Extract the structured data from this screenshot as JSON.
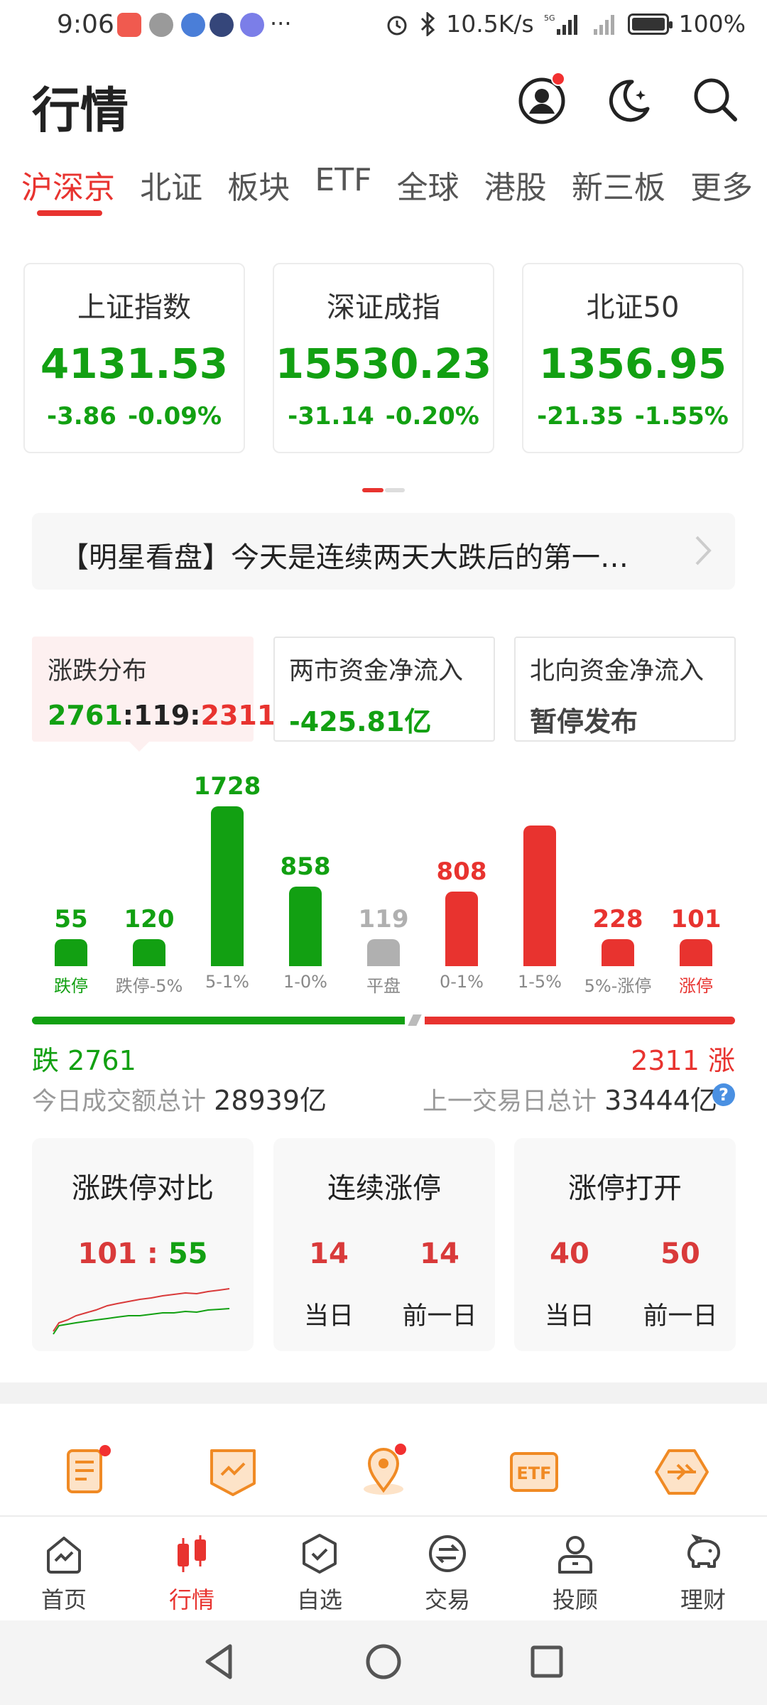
{
  "status_bar": {
    "time": "9:06",
    "more": "···",
    "net_speed": "10.5K/s",
    "network": "5G",
    "battery": "100%"
  },
  "header": {
    "title": "行情",
    "icons": [
      "profile-icon",
      "night-mode-icon",
      "search-icon"
    ]
  },
  "tabs": [
    "沪深京",
    "北证",
    "板块",
    "ETF",
    "全球",
    "港股",
    "新三板",
    "更多"
  ],
  "indices": [
    {
      "name": "上证指数",
      "value": "4131.53",
      "change": "-3.86",
      "pct": "-0.09%"
    },
    {
      "name": "深证成指",
      "value": "15530.23",
      "change": "-31.14",
      "pct": "-0.20%"
    },
    {
      "name": "北证50",
      "value": "1356.95",
      "change": "-21.35",
      "pct": "-1.55%"
    }
  ],
  "news": {
    "text": "【明星看盘】今天是连续两天大跌后的第一…"
  },
  "stats": {
    "distribution": {
      "label": "涨跌分布",
      "fall": "2761",
      "sep1": ":",
      "flat": "119",
      "sep2": ":",
      "rise": "2311"
    },
    "net_flow": {
      "label": "两市资金净流入",
      "value": "-425.81亿"
    },
    "north_flow": {
      "label": "北向资金净流入",
      "value": "暂停发布"
    }
  },
  "chart_data": {
    "type": "bar",
    "categories": [
      "跌停",
      "跌停-5%",
      "5-1%",
      "1-0%",
      "平盘",
      "0-1%",
      "1-5%",
      "5%-涨停",
      "涨停"
    ],
    "values": [
      55,
      120,
      1728,
      858,
      119,
      808,
      null,
      228,
      101
    ],
    "value_labels": [
      "55",
      "120",
      "1728",
      "858",
      "119",
      "808",
      "",
      "228",
      "101"
    ],
    "colors": [
      "#12a012",
      "#12a012",
      "#12a012",
      "#12a012",
      "#b0b0b0",
      "#e8332f",
      "#e8332f",
      "#e8332f",
      "#e8332f"
    ],
    "estimated_hidden_value": 1520
  },
  "totals": {
    "fall_label": "跌 2761",
    "rise_label": "2311 涨",
    "turnover_label": "今日成交额总计",
    "turnover_value": "28939亿",
    "prev_label": "上一交易日总计",
    "prev_value": "33444亿"
  },
  "cards": {
    "limit_compare": {
      "title": "涨跌停对比",
      "up": "101",
      "sep": " : ",
      "down": "55"
    },
    "consecutive": {
      "title": "连续涨停",
      "today": "14",
      "prev": "14",
      "today_label": "当日",
      "prev_label": "前一日"
    },
    "limit_open": {
      "title": "涨停打开",
      "today": "40",
      "prev": "50",
      "today_label": "当日",
      "prev_label": "前一日"
    }
  },
  "tools": [
    "report-icon",
    "trend-badge-icon",
    "location-pin-icon",
    "etf-icon",
    "network-hexagon-icon"
  ],
  "bottom_nav": [
    {
      "label": "首页",
      "icon": "home-chart-icon"
    },
    {
      "label": "行情",
      "icon": "candlestick-icon"
    },
    {
      "label": "自选",
      "icon": "shield-check-icon"
    },
    {
      "label": "交易",
      "icon": "exchange-icon"
    },
    {
      "label": "投顾",
      "icon": "advisor-icon"
    },
    {
      "label": "理财",
      "icon": "piggy-bank-icon"
    }
  ],
  "colors": {
    "accent": "#e8332f",
    "down": "#12a012",
    "up": "#e8332f",
    "flat": "#b0b0b0"
  }
}
